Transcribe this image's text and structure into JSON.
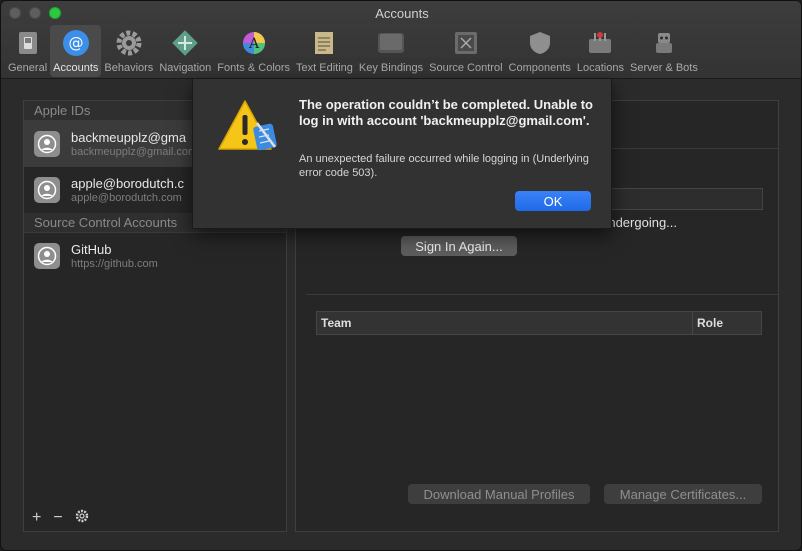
{
  "window": {
    "title": "Accounts"
  },
  "toolbar": {
    "tabs": [
      {
        "label": "General",
        "icon": "switch-icon"
      },
      {
        "label": "Accounts",
        "icon": "at-sign-icon",
        "active": true
      },
      {
        "label": "Behaviors",
        "icon": "gear-icon"
      },
      {
        "label": "Navigation",
        "icon": "move-arrows-icon"
      },
      {
        "label": "Fonts & Colors",
        "icon": "color-wheel-icon"
      },
      {
        "label": "Text Editing",
        "icon": "notepad-icon"
      },
      {
        "label": "Key Bindings",
        "icon": "keyboard-key-icon"
      },
      {
        "label": "Source Control",
        "icon": "source-control-icon"
      },
      {
        "label": "Components",
        "icon": "shield-icon"
      },
      {
        "label": "Locations",
        "icon": "drive-icon"
      },
      {
        "label": "Server & Bots",
        "icon": "robot-icon"
      }
    ]
  },
  "sidebar": {
    "apple_ids_header": "Apple IDs",
    "accounts": [
      {
        "name": "backmeupplz@gma",
        "sub": "backmeupplz@gmail.com"
      },
      {
        "name": "apple@borodutch.c",
        "sub": "apple@borodutch.com"
      }
    ],
    "source_control_header": "Source Control Accounts",
    "source_control_accounts": [
      {
        "name": "GitHub",
        "sub": "https://github.com"
      }
    ],
    "footer": {
      "add": "+",
      "remove": "−",
      "settings_icon": "gear-icon"
    }
  },
  "detail": {
    "status_fragment": "s undergoing...",
    "sign_in_again": "Sign In Again...",
    "table_headers": {
      "team": "Team",
      "role": "Role"
    },
    "download_profiles": "Download Manual Profiles",
    "manage_certificates": "Manage Certificates..."
  },
  "alert": {
    "icon": "warning-xcode-icon",
    "title": "The operation couldn’t be completed. Unable to log in with account 'backmeupplz@gmail.com'.",
    "message": "An unexpected failure occurred while logging in (Underlying error code 503).",
    "ok": "OK"
  },
  "colors": {
    "accent": "#1f6ae8",
    "warning": "#f5c518",
    "close": "#2bc840"
  }
}
